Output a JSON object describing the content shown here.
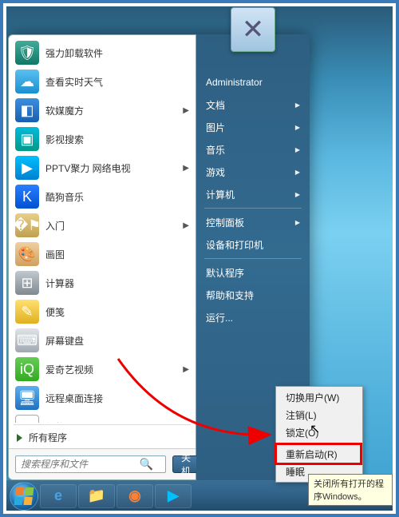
{
  "user": {
    "name": "Administrator"
  },
  "programs": [
    {
      "label": "强力卸载软件",
      "iconClass": "bg-green",
      "glyph": "🛡",
      "expandable": false
    },
    {
      "label": "查看实时天气",
      "iconClass": "bg-sky",
      "glyph": "☁",
      "expandable": false
    },
    {
      "label": "软媒魔方",
      "iconClass": "bg-blue",
      "glyph": "◧",
      "expandable": true
    },
    {
      "label": "影视搜索",
      "iconClass": "bg-teal",
      "glyph": "▣",
      "expandable": false
    },
    {
      "label": "PPTV聚力 网络电视",
      "iconClass": "bg-cyan",
      "glyph": "▶",
      "expandable": true
    },
    {
      "label": "酷狗音乐",
      "iconClass": "bg-blue2",
      "glyph": "K",
      "expandable": false
    },
    {
      "label": "入门",
      "iconClass": "bg-tan",
      "glyph": "�⚑",
      "expandable": true
    },
    {
      "label": "画图",
      "iconClass": "bg-pal",
      "glyph": "🎨",
      "expandable": false
    },
    {
      "label": "计算器",
      "iconClass": "bg-gray",
      "glyph": "⊞",
      "expandable": false
    },
    {
      "label": "便笺",
      "iconClass": "bg-yel",
      "glyph": "✎",
      "expandable": false
    },
    {
      "label": "屏幕键盘",
      "iconClass": "bg-kb",
      "glyph": "⌨",
      "expandable": false
    },
    {
      "label": "爱奇艺视频",
      "iconClass": "bg-grn2",
      "glyph": "iQ",
      "expandable": true
    },
    {
      "label": "远程桌面连接",
      "iconClass": "bg-rd",
      "glyph": "🖥",
      "expandable": false
    },
    {
      "label": "纸牌",
      "iconClass": "bg-wht",
      "glyph": "♠",
      "expandable": false
    }
  ],
  "allPrograms": "所有程序",
  "search": {
    "placeholder": "搜索程序和文件"
  },
  "shutdown": {
    "label": "关机"
  },
  "rightItems": [
    {
      "label": "文档",
      "sub": true
    },
    {
      "label": "图片",
      "sub": true
    },
    {
      "label": "音乐",
      "sub": true
    },
    {
      "label": "游戏",
      "sub": true
    },
    {
      "label": "计算机",
      "sub": true
    },
    {
      "sep": true
    },
    {
      "label": "控制面板",
      "sub": true
    },
    {
      "label": "设备和打印机",
      "sub": false
    },
    {
      "sep": true
    },
    {
      "label": "默认程序",
      "sub": false
    },
    {
      "label": "帮助和支持",
      "sub": false
    },
    {
      "label": "运行...",
      "sub": false
    }
  ],
  "powerMenu": [
    {
      "label": "切换用户(W)"
    },
    {
      "label": "注销(L)"
    },
    {
      "label": "锁定(O)"
    },
    {
      "sep": true
    },
    {
      "label": "重新启动(R)",
      "highlight": true
    },
    {
      "label": "睡眠"
    }
  ],
  "tooltip": "关闭所有打开的程序Windows。",
  "taskbar": {
    "items": [
      {
        "name": "ie",
        "glyph": "e",
        "color": "#4aa0e0"
      },
      {
        "name": "explorer",
        "glyph": "📁",
        "color": "#ffd060"
      },
      {
        "name": "mediaplayer",
        "glyph": "◉",
        "color": "#ff8030"
      },
      {
        "name": "pptv",
        "glyph": "▶",
        "color": "#00c0ff"
      }
    ]
  }
}
